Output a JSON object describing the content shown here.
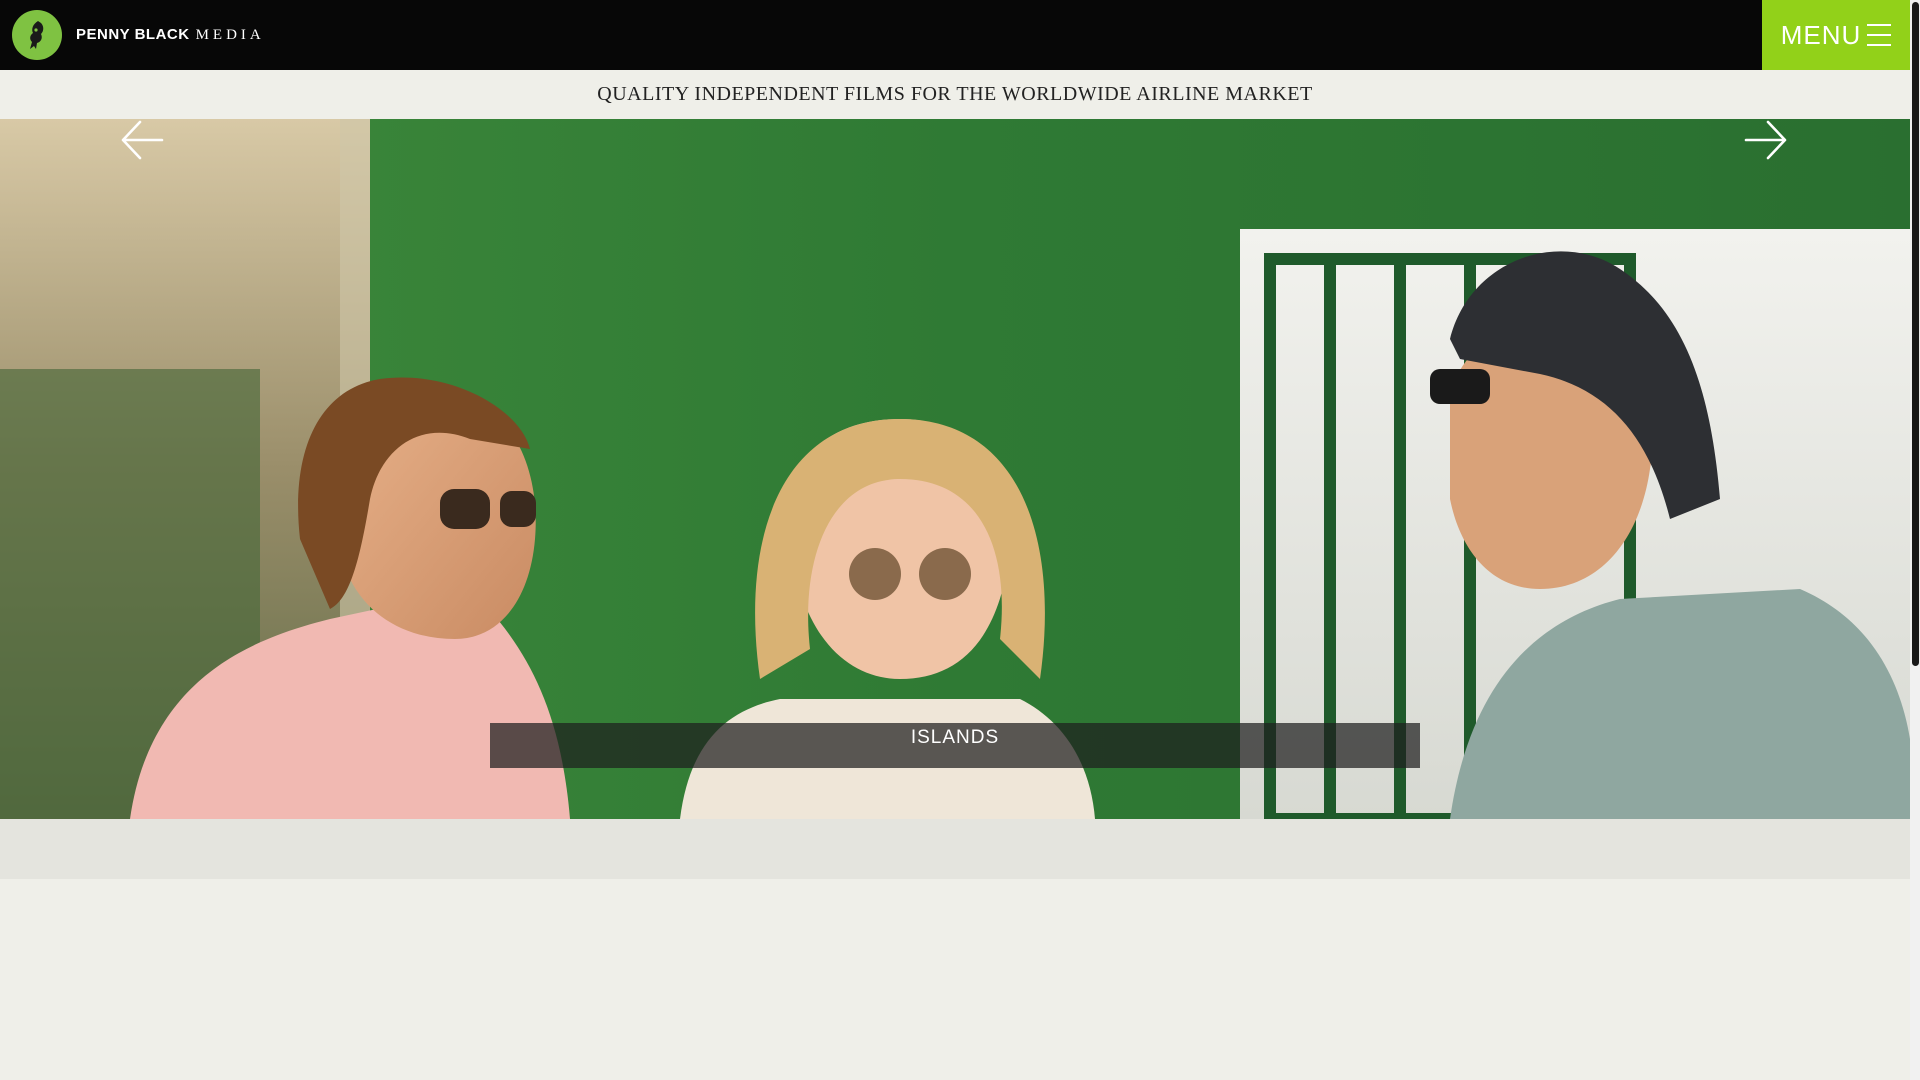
{
  "header": {
    "logo_bold": "PENNY BLACK",
    "logo_light": "MEDIA",
    "menu_label": "MENU",
    "logo_icon": "penny-black-logo-icon",
    "menu_icon": "hamburger-icon",
    "brand_color": "#92d119",
    "logo_badge_color": "#7fc242"
  },
  "tagline": "QUALITY INDEPENDENT FILMS FOR THE WORLDWIDE AIRLINE MARKET",
  "slider": {
    "caption": "ISLANDS",
    "prev_icon": "arrow-left-icon",
    "next_icon": "arrow-right-icon"
  },
  "colors": {
    "header_bg": "#070707",
    "page_bg": "#efefe9",
    "bottom_strip": "#e4e4de"
  }
}
